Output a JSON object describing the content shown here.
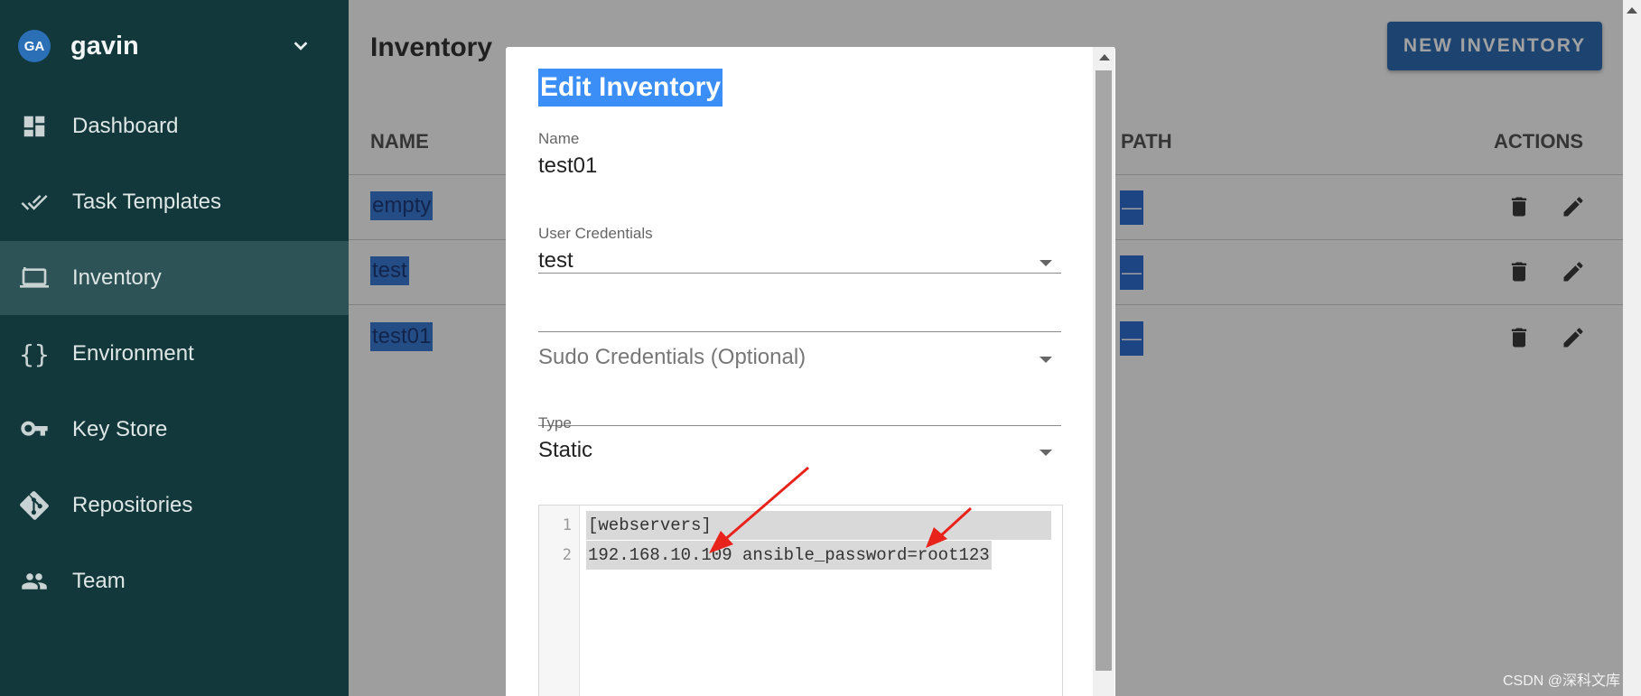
{
  "user": {
    "initials": "GA",
    "name": "gavin"
  },
  "nav": [
    {
      "label": "Dashboard",
      "icon": "dashboard-icon"
    },
    {
      "label": "Task Templates",
      "icon": "double-check-icon"
    },
    {
      "label": "Inventory",
      "icon": "monitor-icon",
      "active": true
    },
    {
      "label": "Environment",
      "icon": "braces-icon"
    },
    {
      "label": "Key Store",
      "icon": "key-icon"
    },
    {
      "label": "Repositories",
      "icon": "git-icon"
    },
    {
      "label": "Team",
      "icon": "people-icon"
    }
  ],
  "page": {
    "title": "Inventory",
    "new_button": "NEW INVENTORY"
  },
  "table": {
    "headers": {
      "name": "NAME",
      "path": "PATH",
      "actions": "ACTIONS"
    },
    "rows": [
      {
        "name": "empty",
        "path": "—"
      },
      {
        "name": "test",
        "path": "—"
      },
      {
        "name": "test01",
        "path": "—"
      }
    ]
  },
  "dialog": {
    "title": "Edit Inventory",
    "name_label": "Name",
    "name_value": "test01",
    "user_cred_label": "User Credentials",
    "user_cred_value": "test",
    "sudo_placeholder": "Sudo Credentials (Optional)",
    "type_label": "Type",
    "type_value": "Static",
    "editor_lines": [
      {
        "num": "1",
        "text": "[webservers]"
      },
      {
        "num": "2",
        "text": "192.168.10.109 ansible_password=root123"
      }
    ]
  },
  "watermark": "CSDN @深科文库",
  "colors": {
    "sidebar": "#12383c",
    "accent": "#2f6cb3",
    "highlight": "#3a8ef6",
    "arrow": "#e8231b"
  }
}
